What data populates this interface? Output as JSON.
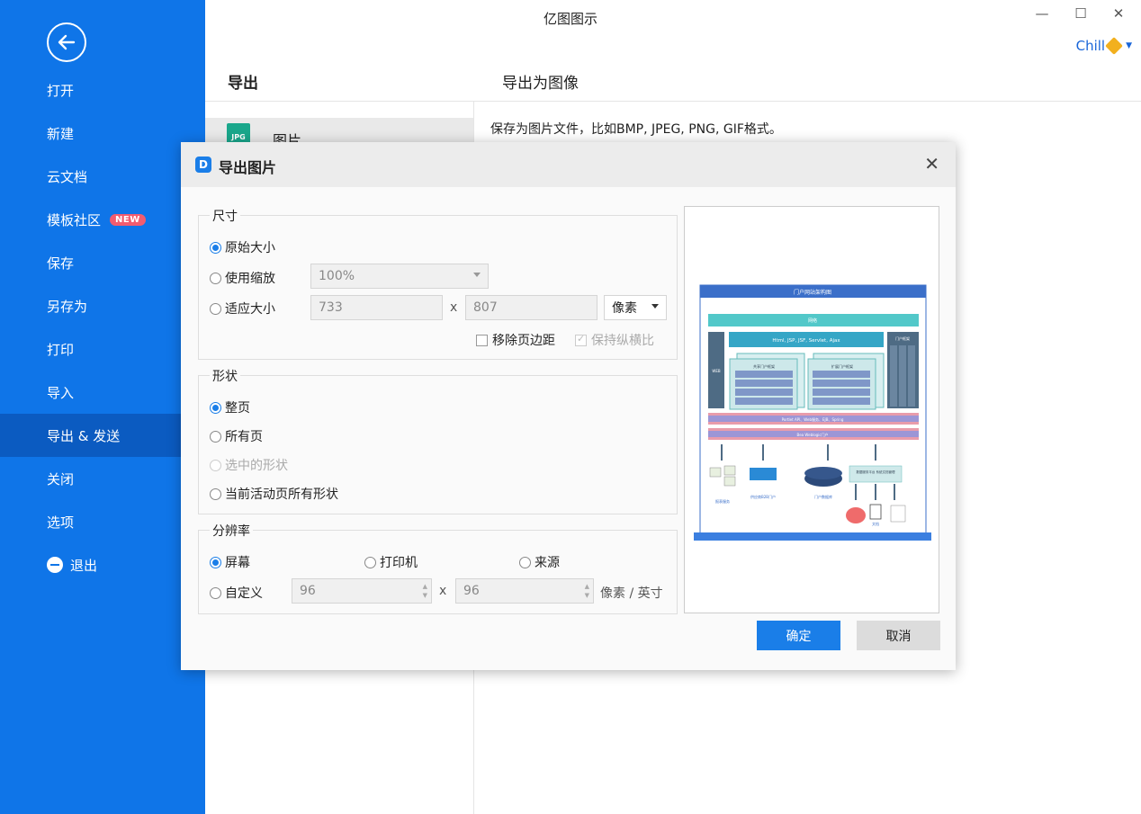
{
  "app": {
    "title": "亿图图示",
    "user": "Chill",
    "minimize": "—",
    "maximize": "☐",
    "close": "✕"
  },
  "sidebar": {
    "items": [
      {
        "label": "打开"
      },
      {
        "label": "新建"
      },
      {
        "label": "云文档"
      },
      {
        "label": "模板社区",
        "badge": "NEW"
      },
      {
        "label": "保存"
      },
      {
        "label": "另存为"
      },
      {
        "label": "打印"
      },
      {
        "label": "导入"
      },
      {
        "label": "导出 & 发送",
        "active": true
      },
      {
        "label": "关闭"
      },
      {
        "label": "选项"
      }
    ],
    "exit_label": "退出"
  },
  "export_panel": {
    "left_heading": "导出",
    "right_heading": "导出为图像",
    "item_label": "图片",
    "item_icon_text": "JPG",
    "description": "保存为图片文件，比如BMP, JPEG, PNG, GIF格式。"
  },
  "dialog": {
    "title": "导出图片",
    "close_glyph": "✕",
    "size": {
      "title": "尺寸",
      "original": "原始大小",
      "use_scale": "使用缩放",
      "scale_value": "100%",
      "fit_size": "适应大小",
      "width": "733",
      "x": "x",
      "height": "807",
      "unit": "像素",
      "remove_margin": "移除页边距",
      "keep_ratio": "保持纵横比"
    },
    "shape": {
      "title": "形状",
      "whole_page": "整页",
      "all_pages": "所有页",
      "selected": "选中的形状",
      "current_page_all": "当前活动页所有形状"
    },
    "resolution": {
      "title": "分辨率",
      "screen": "屏幕",
      "printer": "打印机",
      "source": "来源",
      "custom": "自定义",
      "dpi_x": "96",
      "x": "x",
      "dpi_y": "96",
      "unit": "像素 / 英寸"
    },
    "preview": {
      "title": "门户网站架构图",
      "network": "网络",
      "tech": "Html, JSP, JSF, Servlet, Ajax",
      "left_bar": "WEB",
      "right_header": "门户框架",
      "col_a": "共享门户框架",
      "col_b": "扩展门户框架",
      "col_a_rows": [
        "用户管理门户",
        "权限管理门户",
        "流程整合门户",
        "流程设计门户"
      ],
      "col_b_rows": [
        "应用门户",
        "业务配置门户",
        "应用数据门户",
        "产品设计门户"
      ],
      "right_cols": [
        "资源管理",
        "业务配置",
        "WEB"
      ],
      "portlet": "Portlet API、Web服务、EJB、Spring",
      "bea": "Bea Weblogic门户",
      "bottom_labels": [
        "报表服务",
        "供应商B2B门户",
        "门户数据库",
        "文档"
      ],
      "sys_box": "数据服务平台 系统文档管理"
    },
    "ok": "确定",
    "cancel": "取消"
  }
}
